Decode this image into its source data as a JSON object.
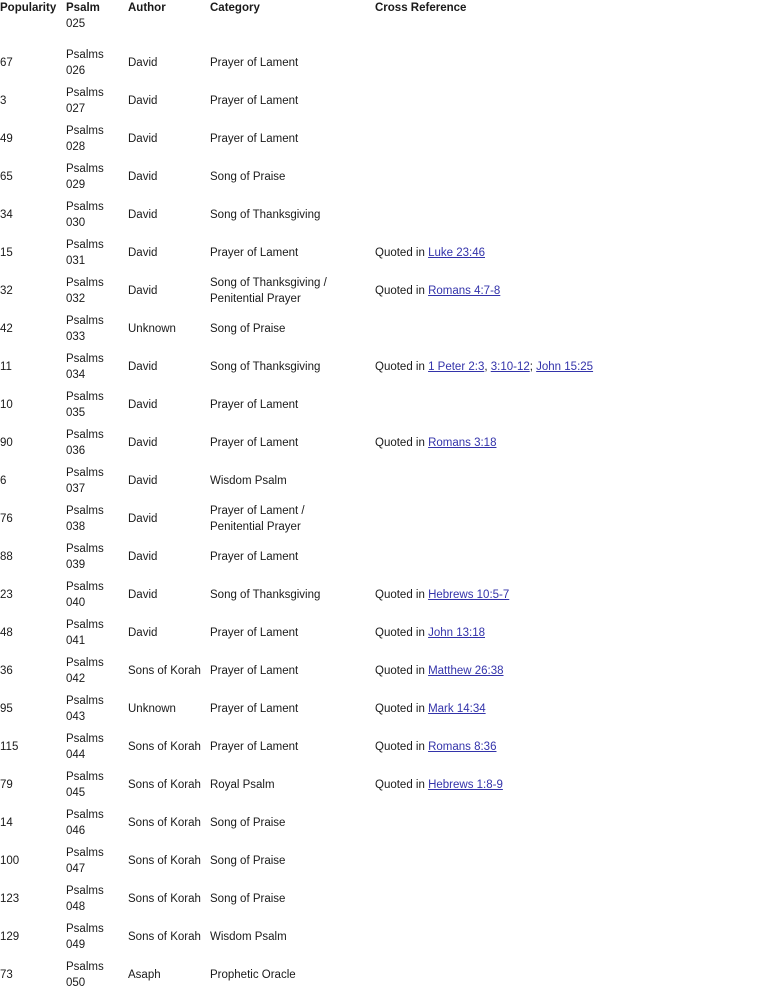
{
  "table": {
    "headers": {
      "popularity": "Popularity",
      "psalm": "Psalm",
      "author": "Author",
      "category": "Category",
      "cross_reference": "Cross Reference"
    },
    "link_color": "#3333AA",
    "text_color": "#1A1A1A",
    "background": "#FFFFFF",
    "clipped_first_row": {
      "psalm_number": "025"
    },
    "quoted_prefix": "Quoted in ",
    "rows": [
      {
        "popularity": "67",
        "psalm_book": "Psalms",
        "psalm_number": "026",
        "author": "David",
        "category": [
          "Prayer of Lament"
        ],
        "xref": {
          "prefix": "",
          "links": [],
          "seps": []
        }
      },
      {
        "popularity": "3",
        "psalm_book": "Psalms",
        "psalm_number": "027",
        "author": "David",
        "category": [
          "Prayer of Lament"
        ],
        "xref": {
          "prefix": "",
          "links": [],
          "seps": []
        }
      },
      {
        "popularity": "49",
        "psalm_book": "Psalms",
        "psalm_number": "028",
        "author": "David",
        "category": [
          "Prayer of Lament"
        ],
        "xref": {
          "prefix": "",
          "links": [],
          "seps": []
        }
      },
      {
        "popularity": "65",
        "psalm_book": "Psalms",
        "psalm_number": "029",
        "author": "David",
        "category": [
          "Song of Praise"
        ],
        "xref": {
          "prefix": "",
          "links": [],
          "seps": []
        }
      },
      {
        "popularity": "34",
        "psalm_book": "Psalms",
        "psalm_number": "030",
        "author": "David",
        "category": [
          "Song of Thanksgiving"
        ],
        "xref": {
          "prefix": "",
          "links": [],
          "seps": []
        }
      },
      {
        "popularity": "15",
        "psalm_book": "Psalms",
        "psalm_number": "031",
        "author": "David",
        "category": [
          "Prayer of Lament"
        ],
        "xref": {
          "prefix": "Quoted in ",
          "links": [
            "Luke 23:46"
          ],
          "seps": []
        }
      },
      {
        "popularity": "32",
        "psalm_book": "Psalms",
        "psalm_number": "032",
        "author": "David",
        "category": [
          "Song of Thanksgiving /",
          "Penitential Prayer"
        ],
        "xref": {
          "prefix": "Quoted in ",
          "links": [
            "Romans 4:7-8"
          ],
          "seps": []
        }
      },
      {
        "popularity": "42",
        "psalm_book": "Psalms",
        "psalm_number": "033",
        "author": "Unknown",
        "category": [
          "Song of Praise"
        ],
        "xref": {
          "prefix": "",
          "links": [],
          "seps": []
        }
      },
      {
        "popularity": "11",
        "psalm_book": "Psalms",
        "psalm_number": "034",
        "author": "David",
        "category": [
          "Song of Thanksgiving"
        ],
        "xref": {
          "prefix": "Quoted in ",
          "links": [
            "1 Peter 2:3",
            "3:10-12",
            "John 15:25"
          ],
          "seps": [
            ", ",
            "; "
          ]
        }
      },
      {
        "popularity": "10",
        "psalm_book": "Psalms",
        "psalm_number": "035",
        "author": "David",
        "category": [
          "Prayer of Lament"
        ],
        "xref": {
          "prefix": "",
          "links": [],
          "seps": []
        }
      },
      {
        "popularity": "90",
        "psalm_book": "Psalms",
        "psalm_number": "036",
        "author": "David",
        "category": [
          "Prayer of Lament"
        ],
        "xref": {
          "prefix": "Quoted in ",
          "links": [
            "Romans 3:18"
          ],
          "seps": []
        }
      },
      {
        "popularity": "6",
        "psalm_book": "Psalms",
        "psalm_number": "037",
        "author": "David",
        "category": [
          "Wisdom Psalm"
        ],
        "xref": {
          "prefix": "",
          "links": [],
          "seps": []
        }
      },
      {
        "popularity": "76",
        "psalm_book": "Psalms",
        "psalm_number": "038",
        "author": "David",
        "category": [
          "Prayer of Lament /",
          "Penitential Prayer"
        ],
        "xref": {
          "prefix": "",
          "links": [],
          "seps": []
        }
      },
      {
        "popularity": "88",
        "psalm_book": "Psalms",
        "psalm_number": "039",
        "author": "David",
        "category": [
          "Prayer of Lament"
        ],
        "xref": {
          "prefix": "",
          "links": [],
          "seps": []
        }
      },
      {
        "popularity": "23",
        "psalm_book": "Psalms",
        "psalm_number": "040",
        "author": "David",
        "category": [
          "Song of Thanksgiving"
        ],
        "xref": {
          "prefix": "Quoted in ",
          "links": [
            "Hebrews 10:5-7"
          ],
          "seps": []
        }
      },
      {
        "popularity": "48",
        "psalm_book": "Psalms",
        "psalm_number": "041",
        "author": "David",
        "category": [
          "Prayer of Lament"
        ],
        "xref": {
          "prefix": "Quoted in ",
          "links": [
            "John 13:18"
          ],
          "seps": []
        }
      },
      {
        "popularity": "36",
        "psalm_book": "Psalms",
        "psalm_number": "042",
        "author": "Sons of Korah",
        "category": [
          "Prayer of Lament"
        ],
        "xref": {
          "prefix": "Quoted in ",
          "links": [
            "Matthew 26:38"
          ],
          "seps": []
        }
      },
      {
        "popularity": "95",
        "psalm_book": "Psalms",
        "psalm_number": "043",
        "author": "Unknown",
        "category": [
          "Prayer of Lament"
        ],
        "xref": {
          "prefix": "Quoted in ",
          "links": [
            "Mark 14:34"
          ],
          "seps": []
        }
      },
      {
        "popularity": "115",
        "psalm_book": "Psalms",
        "psalm_number": "044",
        "author": "Sons of Korah",
        "category": [
          "Prayer of Lament"
        ],
        "xref": {
          "prefix": "Quoted in ",
          "links": [
            "Romans 8:36"
          ],
          "seps": []
        }
      },
      {
        "popularity": "79",
        "psalm_book": "Psalms",
        "psalm_number": "045",
        "author": "Sons of Korah",
        "category": [
          "Royal Psalm"
        ],
        "xref": {
          "prefix": "Quoted in ",
          "links": [
            "Hebrews 1:8-9"
          ],
          "seps": []
        }
      },
      {
        "popularity": "14",
        "psalm_book": "Psalms",
        "psalm_number": "046",
        "author": "Sons of Korah",
        "category": [
          "Song of Praise"
        ],
        "xref": {
          "prefix": "",
          "links": [],
          "seps": []
        }
      },
      {
        "popularity": "100",
        "psalm_book": "Psalms",
        "psalm_number": "047",
        "author": "Sons of Korah",
        "category": [
          "Song of Praise"
        ],
        "xref": {
          "prefix": "",
          "links": [],
          "seps": []
        }
      },
      {
        "popularity": "123",
        "psalm_book": "Psalms",
        "psalm_number": "048",
        "author": "Sons of Korah",
        "category": [
          "Song of Praise"
        ],
        "xref": {
          "prefix": "",
          "links": [],
          "seps": []
        }
      },
      {
        "popularity": "129",
        "psalm_book": "Psalms",
        "psalm_number": "049",
        "author": "Sons of Korah",
        "category": [
          "Wisdom Psalm"
        ],
        "xref": {
          "prefix": "",
          "links": [],
          "seps": []
        }
      },
      {
        "popularity": "73",
        "psalm_book": "Psalms",
        "psalm_number": "050",
        "author": "Asaph",
        "category": [
          "Prophetic Oracle"
        ],
        "xref": {
          "prefix": "",
          "links": [],
          "seps": []
        }
      }
    ]
  }
}
